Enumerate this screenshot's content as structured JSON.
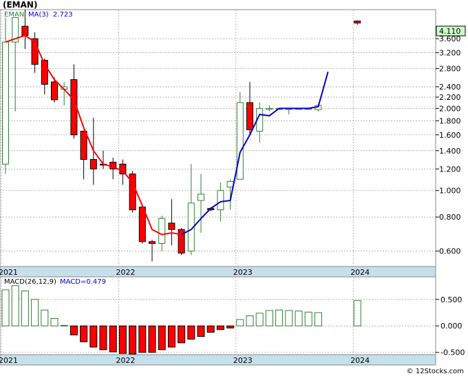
{
  "title": "(EMAN)",
  "credit": "© 12Stocks.com",
  "colors": {
    "up": "#2e7d32",
    "down": "#ff0000",
    "ma": "#0000cc",
    "ma_red": "#ff0000",
    "axis_band": "#c6dfec",
    "macd_bar": "#2e7d32",
    "price_box": "#ccffcc"
  },
  "chart_data": [
    {
      "type": "candlestick",
      "title": "EMAN",
      "scale": "log",
      "legend": {
        "symbol": "EMAN",
        "ma_label": "MA(3)",
        "ma_value": "2.723"
      },
      "last_price": "4.110",
      "yticks": [
        "3.600",
        "3.200",
        "2.800",
        "2.400",
        "2.200",
        "2.000",
        "1.800",
        "1.600",
        "1.400",
        "1.200",
        "1.000",
        "0.800",
        "0.600"
      ],
      "ylim": [
        0.53,
        4.6
      ],
      "xlabels": [
        "2021",
        "2022",
        "2023",
        "2024"
      ],
      "grid": true,
      "candles": [
        {
          "date": "2021-01",
          "o": 1.25,
          "h": 4.3,
          "l": 1.15,
          "c": 3.5
        },
        {
          "date": "2021-02",
          "o": 3.5,
          "h": 4.3,
          "l": 1.95,
          "c": 4.3
        },
        {
          "date": "2021-03",
          "o": 4.0,
          "h": 4.6,
          "l": 3.3,
          "c": 3.7
        },
        {
          "date": "2021-04",
          "o": 3.6,
          "h": 3.8,
          "l": 2.7,
          "c": 2.9
        },
        {
          "date": "2021-05",
          "o": 3.0,
          "h": 3.05,
          "l": 2.25,
          "c": 2.45
        },
        {
          "date": "2021-06",
          "o": 2.5,
          "h": 2.6,
          "l": 2.1,
          "c": 2.15
        },
        {
          "date": "2021-07",
          "o": 2.35,
          "h": 2.5,
          "l": 2.05,
          "c": 2.4
        },
        {
          "date": "2021-08",
          "o": 2.55,
          "h": 2.9,
          "l": 1.55,
          "c": 1.6
        },
        {
          "date": "2021-09",
          "o": 1.65,
          "h": 1.66,
          "l": 1.1,
          "c": 1.3
        },
        {
          "date": "2021-10",
          "o": 1.3,
          "h": 1.85,
          "l": 1.05,
          "c": 1.2
        },
        {
          "date": "2021-11",
          "o": 1.25,
          "h": 1.4,
          "l": 1.2,
          "c": 1.24
        },
        {
          "date": "2021-12",
          "o": 1.27,
          "h": 1.32,
          "l": 1.1,
          "c": 1.2
        },
        {
          "date": "2022-01",
          "o": 1.25,
          "h": 1.3,
          "l": 1.05,
          "c": 1.15
        },
        {
          "date": "2022-02",
          "o": 1.15,
          "h": 1.18,
          "l": 0.83,
          "c": 0.85
        },
        {
          "date": "2022-03",
          "o": 0.87,
          "h": 0.87,
          "l": 0.64,
          "c": 0.65
        },
        {
          "date": "2022-04",
          "o": 0.65,
          "h": 0.66,
          "l": 0.55,
          "c": 0.64
        },
        {
          "date": "2022-05",
          "o": 0.64,
          "h": 0.81,
          "l": 0.6,
          "c": 0.79
        },
        {
          "date": "2022-06",
          "o": 0.76,
          "h": 0.93,
          "l": 0.63,
          "c": 0.72
        },
        {
          "date": "2022-07",
          "o": 0.72,
          "h": 0.73,
          "l": 0.58,
          "c": 0.59
        },
        {
          "date": "2022-08",
          "o": 0.6,
          "h": 1.25,
          "l": 0.58,
          "c": 0.9
        },
        {
          "date": "2022-09",
          "o": 0.92,
          "h": 1.15,
          "l": 0.7,
          "c": 0.97
        },
        {
          "date": "2022-10",
          "o": 0.86,
          "h": 0.87,
          "l": 0.84,
          "c": 0.85
        },
        {
          "date": "2022-11",
          "o": 0.85,
          "h": 1.07,
          "l": 0.77,
          "c": 1.0
        },
        {
          "date": "2022-12",
          "o": 1.03,
          "h": 1.1,
          "l": 0.85,
          "c": 1.08
        },
        {
          "date": "2023-01",
          "o": 1.1,
          "h": 2.3,
          "l": 1.1,
          "c": 2.1
        },
        {
          "date": "2023-02",
          "o": 2.1,
          "h": 2.5,
          "l": 1.6,
          "c": 1.67
        },
        {
          "date": "2023-03",
          "o": 1.65,
          "h": 2.1,
          "l": 1.5,
          "c": 2.0
        },
        {
          "date": "2023-04",
          "o": 2.0,
          "h": 2.05,
          "l": 1.95,
          "c": 2.0
        },
        {
          "date": "2023-05",
          "o": 2.0,
          "h": 2.01,
          "l": 1.99,
          "c": 2.0
        },
        {
          "date": "2023-06",
          "o": 2.0,
          "h": 2.0,
          "l": 1.9,
          "c": 2.0
        },
        {
          "date": "2023-07",
          "o": 2.0,
          "h": 2.01,
          "l": 1.99,
          "c": 2.0
        },
        {
          "date": "2023-08",
          "o": 2.0,
          "h": 2.01,
          "l": 1.99,
          "c": 2.0
        },
        {
          "date": "2023-09",
          "o": 1.98,
          "h": 2.05,
          "l": 1.95,
          "c": 2.05
        },
        {
          "date": "2024-01",
          "o": 4.18,
          "h": 4.2,
          "l": 4.05,
          "c": 4.11
        }
      ],
      "ma": [
        {
          "date": "2021-01",
          "v": 3.5
        },
        {
          "date": "2021-02",
          "v": 3.6
        },
        {
          "date": "2021-03",
          "v": 3.7
        },
        {
          "date": "2021-04",
          "v": 3.5
        },
        {
          "date": "2021-05",
          "v": 2.9
        },
        {
          "date": "2021-06",
          "v": 2.55
        },
        {
          "date": "2021-07",
          "v": 2.35
        },
        {
          "date": "2021-08",
          "v": 2.15
        },
        {
          "date": "2021-09",
          "v": 1.7
        },
        {
          "date": "2021-10",
          "v": 1.4
        },
        {
          "date": "2021-11",
          "v": 1.25
        },
        {
          "date": "2021-12",
          "v": 1.22
        },
        {
          "date": "2022-01",
          "v": 1.18
        },
        {
          "date": "2022-02",
          "v": 1.07
        },
        {
          "date": "2022-03",
          "v": 0.88
        },
        {
          "date": "2022-04",
          "v": 0.72
        },
        {
          "date": "2022-05",
          "v": 0.69
        },
        {
          "date": "2022-06",
          "v": 0.7
        },
        {
          "date": "2022-07",
          "v": 0.69
        },
        {
          "date": "2022-08",
          "v": 0.72
        },
        {
          "date": "2022-09",
          "v": 0.79
        },
        {
          "date": "2022-10",
          "v": 0.86
        },
        {
          "date": "2022-11",
          "v": 0.91
        },
        {
          "date": "2022-12",
          "v": 0.92
        },
        {
          "date": "2023-01",
          "v": 1.38
        },
        {
          "date": "2023-02",
          "v": 1.6
        },
        {
          "date": "2023-03",
          "v": 1.9
        },
        {
          "date": "2023-04",
          "v": 1.88
        },
        {
          "date": "2023-05",
          "v": 2.0
        },
        {
          "date": "2023-06",
          "v": 2.0
        },
        {
          "date": "2023-07",
          "v": 2.0
        },
        {
          "date": "2023-08",
          "v": 2.0
        },
        {
          "date": "2023-09",
          "v": 2.03
        },
        {
          "date": "2023-10",
          "v": 2.723
        }
      ]
    },
    {
      "type": "bar",
      "title": "MACD",
      "legend": {
        "label": "MACD(26,12,9)",
        "value_label": "MACD=0.479"
      },
      "yticks": [
        "0.500",
        "0.000",
        "-0.500"
      ],
      "ylim": [
        -0.53,
        0.9
      ],
      "xlabels": [
        "2021",
        "2022",
        "2023",
        "2024"
      ],
      "values": [
        0.68,
        0.76,
        0.66,
        0.5,
        0.3,
        0.14,
        0.01,
        -0.17,
        -0.3,
        -0.4,
        -0.45,
        -0.49,
        -0.52,
        -0.53,
        -0.5,
        -0.5,
        -0.45,
        -0.4,
        -0.32,
        -0.25,
        -0.2,
        -0.12,
        -0.07,
        -0.04,
        0.12,
        0.19,
        0.24,
        0.29,
        0.3,
        0.29,
        0.28,
        0.26,
        0.25,
        0.479
      ]
    }
  ]
}
